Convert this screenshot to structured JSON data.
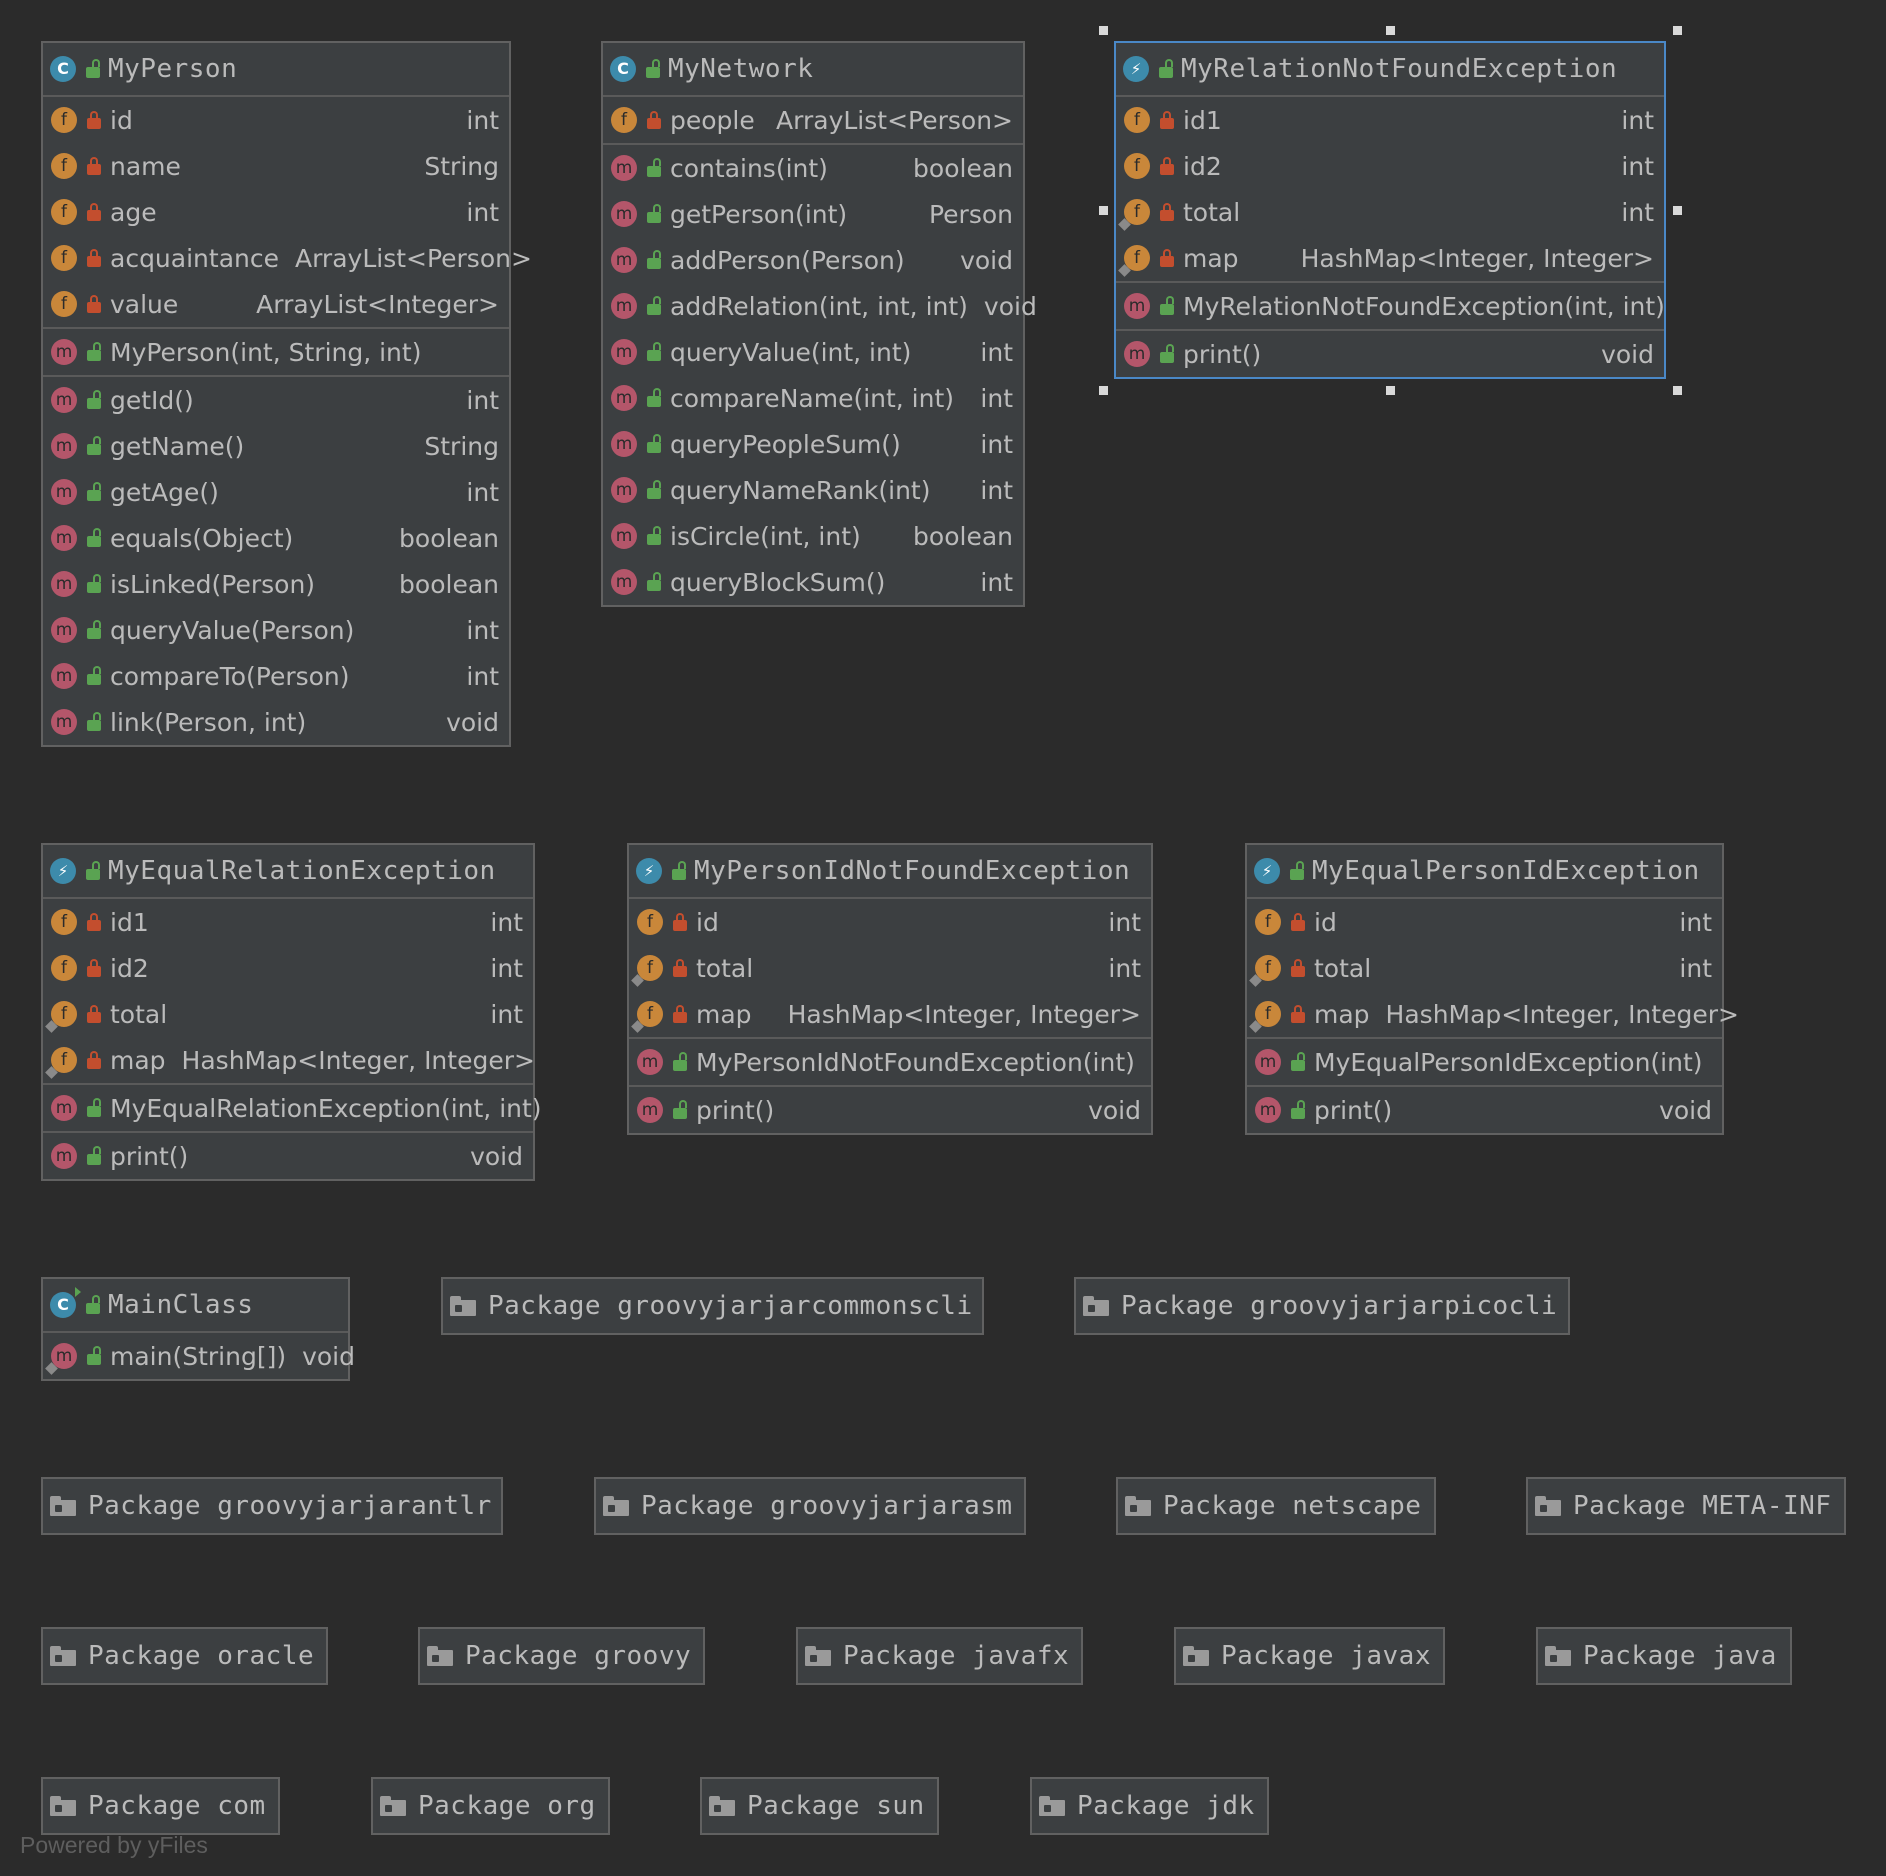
{
  "classes": [
    {
      "key": "myperson",
      "kind": "class",
      "name": "MyPerson",
      "sections": [
        [
          {
            "kind": "f",
            "vis": "private",
            "label": "id",
            "type": "int"
          },
          {
            "kind": "f",
            "vis": "private",
            "label": "name",
            "type": "String"
          },
          {
            "kind": "f",
            "vis": "private",
            "label": "age",
            "type": "int"
          },
          {
            "kind": "f",
            "vis": "private",
            "label": "acquaintance",
            "type": "ArrayList<Person>"
          },
          {
            "kind": "f",
            "vis": "private",
            "label": "value",
            "type": "ArrayList<Integer>"
          }
        ],
        [
          {
            "kind": "m",
            "vis": "public",
            "label": "MyPerson(int, String, int)",
            "type": ""
          }
        ],
        [
          {
            "kind": "m",
            "vis": "public",
            "label": "getId()",
            "type": "int"
          },
          {
            "kind": "m",
            "vis": "public",
            "label": "getName()",
            "type": "String"
          },
          {
            "kind": "m",
            "vis": "public",
            "label": "getAge()",
            "type": "int"
          },
          {
            "kind": "m",
            "vis": "public",
            "label": "equals(Object)",
            "type": "boolean"
          },
          {
            "kind": "m",
            "vis": "public",
            "label": "isLinked(Person)",
            "type": "boolean"
          },
          {
            "kind": "m",
            "vis": "public",
            "label": "queryValue(Person)",
            "type": "int"
          },
          {
            "kind": "m",
            "vis": "public",
            "label": "compareTo(Person)",
            "type": "int"
          },
          {
            "kind": "m",
            "vis": "public",
            "label": "link(Person, int)",
            "type": "void"
          }
        ]
      ]
    },
    {
      "key": "mynetwork",
      "kind": "class",
      "name": "MyNetwork",
      "sections": [
        [
          {
            "kind": "f",
            "vis": "private",
            "label": "people",
            "type": "ArrayList<Person>"
          }
        ],
        [
          {
            "kind": "m",
            "vis": "public",
            "label": "contains(int)",
            "type": "boolean"
          },
          {
            "kind": "m",
            "vis": "public",
            "label": "getPerson(int)",
            "type": "Person"
          },
          {
            "kind": "m",
            "vis": "public",
            "label": "addPerson(Person)",
            "type": "void"
          },
          {
            "kind": "m",
            "vis": "public",
            "label": "addRelation(int, int, int)",
            "type": "void"
          },
          {
            "kind": "m",
            "vis": "public",
            "label": "queryValue(int, int)",
            "type": "int"
          },
          {
            "kind": "m",
            "vis": "public",
            "label": "compareName(int, int)",
            "type": "int"
          },
          {
            "kind": "m",
            "vis": "public",
            "label": "queryPeopleSum()",
            "type": "int"
          },
          {
            "kind": "m",
            "vis": "public",
            "label": "queryNameRank(int)",
            "type": "int"
          },
          {
            "kind": "m",
            "vis": "public",
            "label": "isCircle(int, int)",
            "type": "boolean"
          },
          {
            "kind": "m",
            "vis": "public",
            "label": "queryBlockSum()",
            "type": "int"
          }
        ]
      ]
    },
    {
      "key": "myrelationnotfoundexception",
      "kind": "exception",
      "name": "MyRelationNotFoundException",
      "selected": true,
      "sections": [
        [
          {
            "kind": "f",
            "vis": "private",
            "label": "id1",
            "type": "int"
          },
          {
            "kind": "f",
            "vis": "private",
            "label": "id2",
            "type": "int"
          },
          {
            "kind": "f",
            "vis": "private",
            "static": true,
            "label": "total",
            "type": "int"
          },
          {
            "kind": "f",
            "vis": "private",
            "static": true,
            "label": "map",
            "type": "HashMap<Integer, Integer>"
          }
        ],
        [
          {
            "kind": "m",
            "vis": "public",
            "label": "MyRelationNotFoundException(int, int)",
            "type": ""
          }
        ],
        [
          {
            "kind": "m",
            "vis": "public",
            "label": "print()",
            "type": "void"
          }
        ]
      ]
    },
    {
      "key": "myequalrelationexception",
      "kind": "exception",
      "name": "MyEqualRelationException",
      "sections": [
        [
          {
            "kind": "f",
            "vis": "private",
            "label": "id1",
            "type": "int"
          },
          {
            "kind": "f",
            "vis": "private",
            "label": "id2",
            "type": "int"
          },
          {
            "kind": "f",
            "vis": "private",
            "static": true,
            "label": "total",
            "type": "int"
          },
          {
            "kind": "f",
            "vis": "private",
            "static": true,
            "label": "map",
            "type": "HashMap<Integer, Integer>"
          }
        ],
        [
          {
            "kind": "m",
            "vis": "public",
            "label": "MyEqualRelationException(int, int)",
            "type": ""
          }
        ],
        [
          {
            "kind": "m",
            "vis": "public",
            "label": "print()",
            "type": "void"
          }
        ]
      ]
    },
    {
      "key": "mypersonidnotfoundexception",
      "kind": "exception",
      "name": "MyPersonIdNotFoundException",
      "sections": [
        [
          {
            "kind": "f",
            "vis": "private",
            "label": "id",
            "type": "int"
          },
          {
            "kind": "f",
            "vis": "private",
            "static": true,
            "label": "total",
            "type": "int"
          },
          {
            "kind": "f",
            "vis": "private",
            "static": true,
            "label": "map",
            "type": "HashMap<Integer, Integer>"
          }
        ],
        [
          {
            "kind": "m",
            "vis": "public",
            "label": "MyPersonIdNotFoundException(int)",
            "type": ""
          }
        ],
        [
          {
            "kind": "m",
            "vis": "public",
            "label": "print()",
            "type": "void"
          }
        ]
      ]
    },
    {
      "key": "myequalpersonidexception",
      "kind": "exception",
      "name": "MyEqualPersonIdException",
      "sections": [
        [
          {
            "kind": "f",
            "vis": "private",
            "label": "id",
            "type": "int"
          },
          {
            "kind": "f",
            "vis": "private",
            "static": true,
            "label": "total",
            "type": "int"
          },
          {
            "kind": "f",
            "vis": "private",
            "static": true,
            "label": "map",
            "type": "HashMap<Integer, Integer>"
          }
        ],
        [
          {
            "kind": "m",
            "vis": "public",
            "label": "MyEqualPersonIdException(int)",
            "type": ""
          }
        ],
        [
          {
            "kind": "m",
            "vis": "public",
            "label": "print()",
            "type": "void"
          }
        ]
      ]
    },
    {
      "key": "mainclass",
      "kind": "mainclass",
      "name": "MainClass",
      "sections": [
        [
          {
            "kind": "m",
            "vis": "public",
            "static": true,
            "label": "main(String[])",
            "type": "void"
          }
        ]
      ]
    }
  ],
  "packages": [
    {
      "key": "groovyjarjarcommonscli",
      "label": "Package groovyjarjarcommonscli"
    },
    {
      "key": "groovyjarjarpicocli",
      "label": "Package groovyjarjarpicocli"
    },
    {
      "key": "groovyjarjarantlr",
      "label": "Package groovyjarjarantlr"
    },
    {
      "key": "groovyjarjarasm",
      "label": "Package groovyjarjarasm"
    },
    {
      "key": "netscape",
      "label": "Package netscape"
    },
    {
      "key": "meta-inf",
      "label": "Package META-INF"
    },
    {
      "key": "oracle",
      "label": "Package oracle"
    },
    {
      "key": "groovy",
      "label": "Package groovy"
    },
    {
      "key": "javafx",
      "label": "Package javafx"
    },
    {
      "key": "javax",
      "label": "Package javax"
    },
    {
      "key": "java",
      "label": "Package java"
    },
    {
      "key": "com",
      "label": "Package com"
    },
    {
      "key": "org",
      "label": "Package org"
    },
    {
      "key": "sun",
      "label": "Package sun"
    },
    {
      "key": "jdk",
      "label": "Package jdk"
    }
  ],
  "icons": {
    "class": "class-icon",
    "exception": "exception-icon",
    "mainclass": "main-class-icon",
    "field": "field-icon",
    "method": "method-icon",
    "private": "private-lock-icon",
    "public": "public-lock-icon",
    "package": "folder-icon"
  },
  "colors": {
    "background": "#2b2b2b",
    "node": "#3c3f41",
    "border": "#616161",
    "selection": "#4a88c7",
    "field": "#c9873a",
    "method": "#b4566a",
    "class": "#3d8bab",
    "private": "#c34e2e",
    "public": "#5aa352"
  },
  "footer": "Powered by yFiles"
}
